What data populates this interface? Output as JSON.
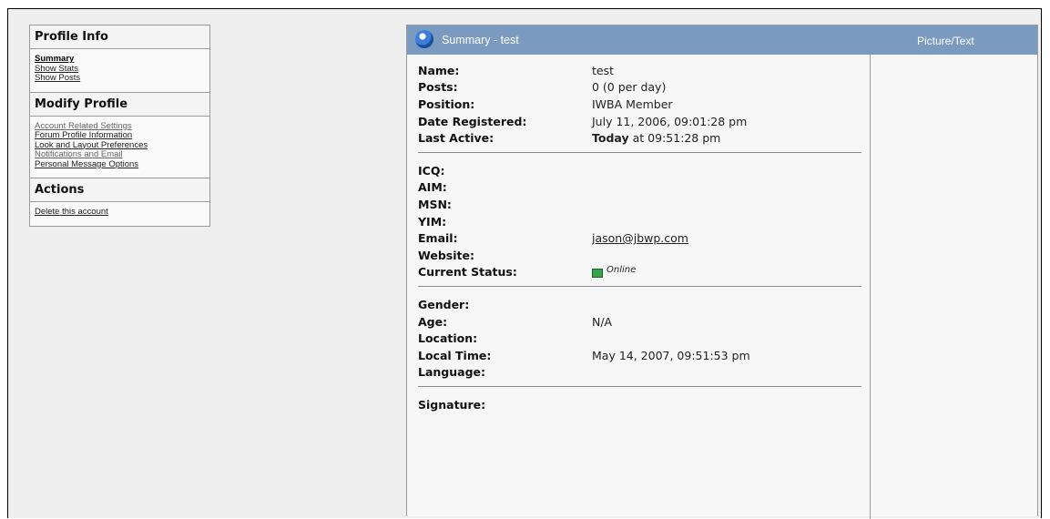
{
  "sidebar": {
    "profile_info": {
      "title": "Profile Info",
      "items": [
        "Summary",
        "Show Stats",
        "Show Posts"
      ]
    },
    "modify_profile": {
      "title": "Modify Profile",
      "items": [
        "Account Related Settings",
        "Forum Profile Information",
        "Look and Layout Preferences",
        "Notifications and Email",
        "Personal Message Options"
      ]
    },
    "actions": {
      "title": "Actions",
      "items": [
        "Delete this account"
      ]
    }
  },
  "header": {
    "title": "Summary - test",
    "picture_text": "Picture/Text"
  },
  "profile": {
    "name_label": "Name:",
    "name": "test",
    "posts_label": "Posts:",
    "posts": "0 (0 per day)",
    "position_label": "Position:",
    "position": "IWBA Member",
    "registered_label": "Date Registered:",
    "registered": "July 11, 2006, 09:01:28 pm",
    "last_active_label": "Last Active:",
    "last_active_bold": "Today",
    "last_active_rest": " at 09:51:28 pm",
    "icq_label": "ICQ:",
    "aim_label": "AIM:",
    "msn_label": "MSN:",
    "yim_label": "YIM:",
    "email_label": "Email:",
    "email": "jason@jbwp.com",
    "website_label": "Website:",
    "status_label": "Current Status:",
    "status": "Online",
    "gender_label": "Gender:",
    "age_label": "Age:",
    "age": "N/A",
    "location_label": "Location:",
    "local_time_label": "Local Time:",
    "local_time": "May 14, 2007, 09:51:53 pm",
    "language_label": "Language:",
    "signature_label": "Signature:"
  },
  "colors": {
    "title_bar": "#7a9bbf",
    "online_icon": "#3aa34a"
  }
}
